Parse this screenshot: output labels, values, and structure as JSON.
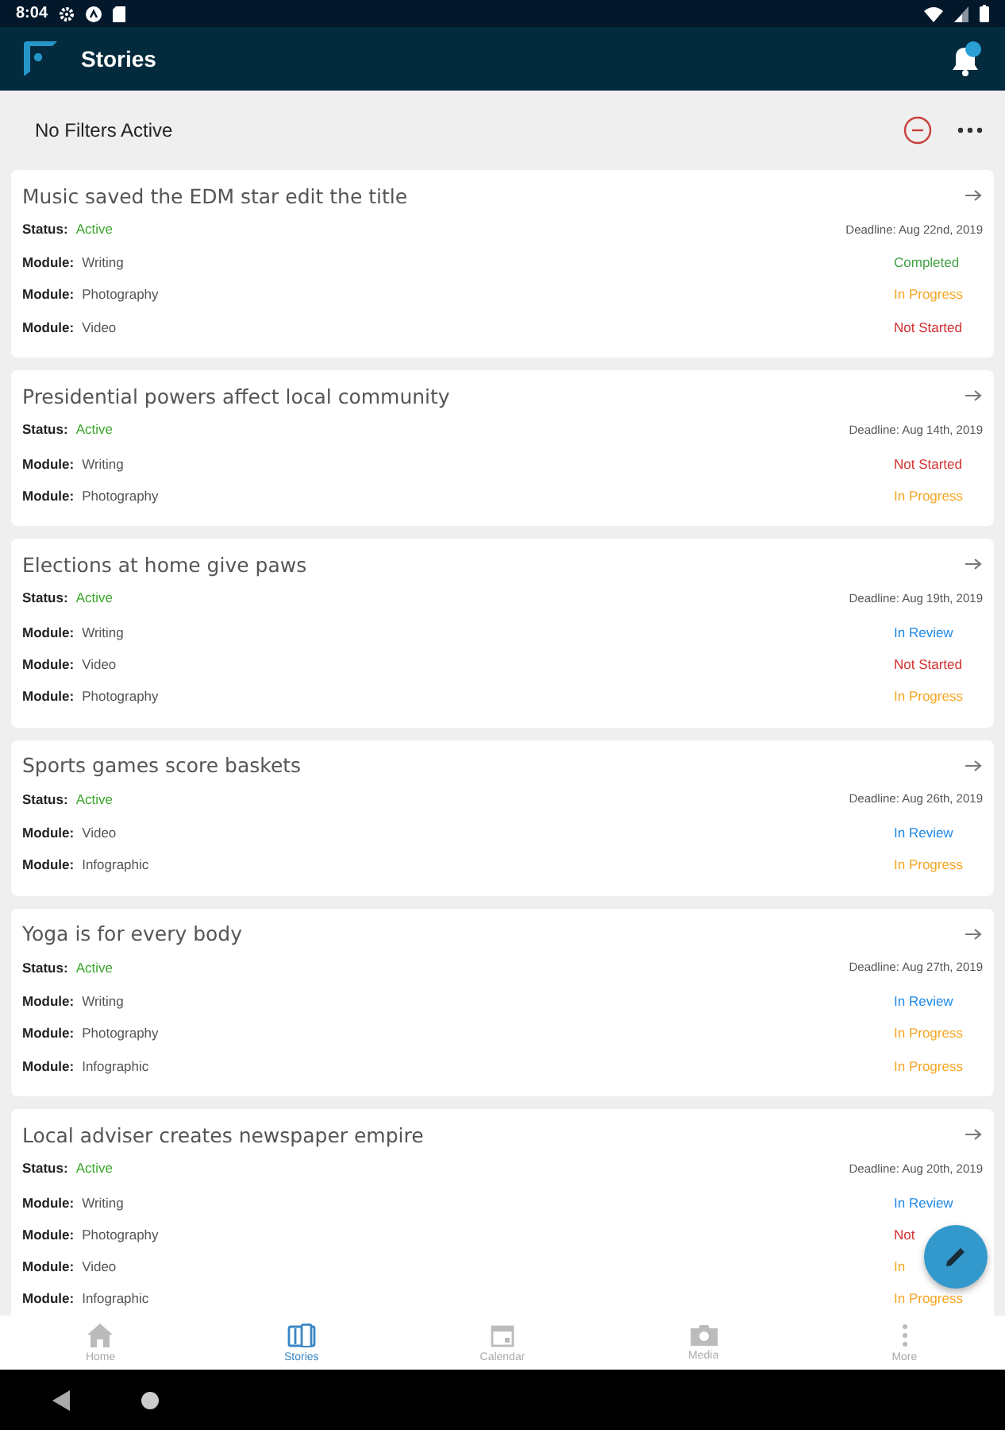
{
  "status_bar": {
    "time": "8:04"
  },
  "app_bar": {
    "title": "Stories"
  },
  "filter_bar": {
    "label": "No Filters Active"
  },
  "stories": [
    {
      "title": "Music saved the EDM star edit the title",
      "status_label": "Status:",
      "status": "Active",
      "deadline": "Deadline: Aug 22nd, 2019",
      "modules": [
        {
          "label": "Module:",
          "name": "Writing",
          "status": "Completed",
          "color": "#43a047"
        },
        {
          "label": "Module:",
          "name": "Photography",
          "status": "In Progress",
          "color": "#f5a623"
        },
        {
          "label": "Module:",
          "name": "Video",
          "status": "Not Started",
          "color": "#d32f2f"
        }
      ]
    },
    {
      "title": "Presidential powers affect local community",
      "status_label": "Status:",
      "status": "Active",
      "deadline": "Deadline: Aug 14th, 2019",
      "modules": [
        {
          "label": "Module:",
          "name": "Writing",
          "status": "Not Started",
          "color": "#d32f2f"
        },
        {
          "label": "Module:",
          "name": "Photography",
          "status": "In Progress",
          "color": "#f5a623"
        }
      ]
    },
    {
      "title": "Elections at home give paws",
      "status_label": "Status:",
      "status": "Active",
      "deadline": "Deadline: Aug 19th, 2019",
      "modules": [
        {
          "label": "Module:",
          "name": "Writing",
          "status": "In Review",
          "color": "#1e88e5"
        },
        {
          "label": "Module:",
          "name": "Video",
          "status": "Not Started",
          "color": "#d32f2f"
        },
        {
          "label": "Module:",
          "name": "Photography",
          "status": "In Progress",
          "color": "#f5a623"
        }
      ]
    },
    {
      "title": "Sports games score baskets",
      "status_label": "Status:",
      "status": "Active",
      "deadline": "Deadline: Aug 26th, 2019",
      "modules": [
        {
          "label": "Module:",
          "name": "Video",
          "status": "In Review",
          "color": "#1e88e5"
        },
        {
          "label": "Module:",
          "name": "Infographic",
          "status": "In Progress",
          "color": "#f5a623"
        }
      ]
    },
    {
      "title": "Yoga is for every body",
      "status_label": "Status:",
      "status": "Active",
      "deadline": "Deadline: Aug 27th, 2019",
      "modules": [
        {
          "label": "Module:",
          "name": "Writing",
          "status": "In Review",
          "color": "#1e88e5"
        },
        {
          "label": "Module:",
          "name": "Photography",
          "status": "In Progress",
          "color": "#f5a623"
        },
        {
          "label": "Module:",
          "name": "Infographic",
          "status": "In Progress",
          "color": "#f5a623"
        }
      ]
    },
    {
      "title": "Local adviser creates newspaper empire",
      "status_label": "Status:",
      "status": "Active",
      "deadline": "Deadline: Aug 20th, 2019",
      "modules": [
        {
          "label": "Module:",
          "name": "Writing",
          "status": "In Review",
          "color": "#1e88e5"
        },
        {
          "label": "Module:",
          "name": "Photography",
          "status": "Not",
          "color": "#d32f2f"
        },
        {
          "label": "Module:",
          "name": "Video",
          "status": "In",
          "color": "#f5a623"
        },
        {
          "label": "Module:",
          "name": "Infographic",
          "status": "In Progress",
          "color": "#f5a623"
        }
      ]
    }
  ],
  "bottom_nav": [
    {
      "kind": "home",
      "label": "Home",
      "selected": false
    },
    {
      "kind": "stories",
      "label": "Stories",
      "selected": true
    },
    {
      "kind": "calendar",
      "label": "Calendar",
      "selected": false
    },
    {
      "kind": "media",
      "label": "Media",
      "selected": false
    },
    {
      "kind": "more",
      "label": "More",
      "selected": false
    }
  ]
}
